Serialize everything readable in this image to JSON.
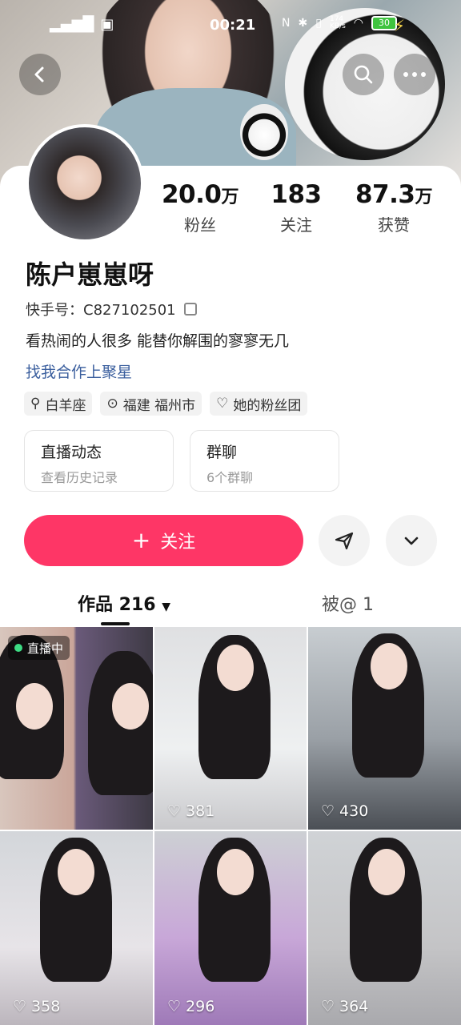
{
  "status_bar": {
    "time": "00:21",
    "net_speed": "174\nKB/s",
    "battery": "30"
  },
  "profile": {
    "name": "陈户崽崽呀",
    "kuaishou_id": "快手号：C827102501",
    "bio": "看热闹的人很多 能替你解围的寥寥无几",
    "cooperation_link": "找我合作上聚星",
    "stats": [
      {
        "value": "20.0",
        "unit": "万",
        "label": "粉丝"
      },
      {
        "value": "183",
        "unit": "",
        "label": "关注"
      },
      {
        "value": "87.3",
        "unit": "万",
        "label": "获赞"
      }
    ],
    "tags": [
      {
        "icon": "zodiac-icon",
        "label": "白羊座"
      },
      {
        "icon": "location-pin-icon",
        "label": "福建 福州市"
      },
      {
        "icon": "heart-outline-icon",
        "label": "她的粉丝团"
      }
    ],
    "info_cards": [
      {
        "title": "直播动态",
        "subtitle": "查看历史记录"
      },
      {
        "title": "群聊",
        "subtitle": "6个群聊"
      }
    ]
  },
  "actions": {
    "follow_label": "关注"
  },
  "tabs": {
    "works": "作品 216",
    "mentioned": "被@ 1"
  },
  "grid": {
    "live_label": "直播中",
    "likes": [
      "381",
      "430",
      "358",
      "296",
      "364"
    ]
  },
  "colors": {
    "accent": "#fe3666",
    "link": "#3b5f9e"
  }
}
